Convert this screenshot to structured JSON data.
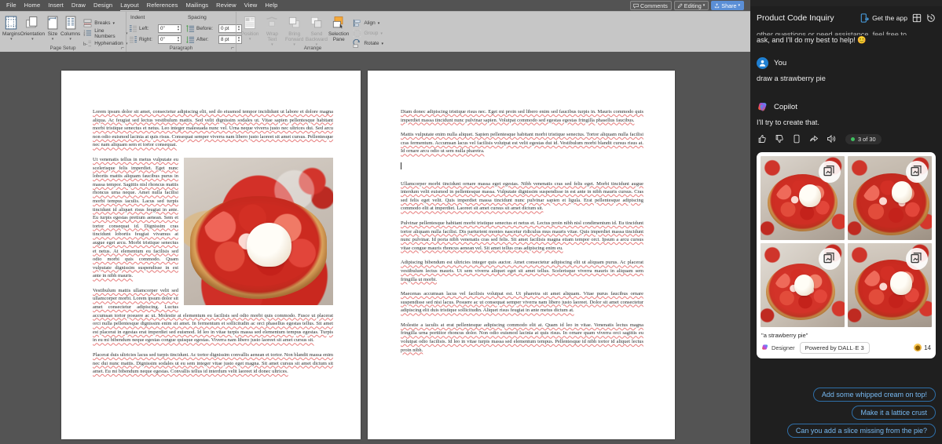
{
  "app": {
    "menu": [
      {
        "label": "File",
        "active": false
      },
      {
        "label": "Home",
        "active": false
      },
      {
        "label": "Insert",
        "active": false
      },
      {
        "label": "Draw",
        "active": false
      },
      {
        "label": "Design",
        "active": false
      },
      {
        "label": "Layout",
        "active": true
      },
      {
        "label": "References",
        "active": false
      },
      {
        "label": "Mailings",
        "active": false
      },
      {
        "label": "Review",
        "active": false
      },
      {
        "label": "View",
        "active": false
      },
      {
        "label": "Help",
        "active": false
      }
    ],
    "menu_right": {
      "comments_label": "Comments",
      "comments_icon": "comment-icon",
      "editing_label": "Editing",
      "editing_icon": "pencil-icon",
      "editing_caret": "▾",
      "share_label": "Share",
      "share_icon": "share-icon",
      "share_caret": "▾",
      "share_color": "#5b8fd6"
    }
  },
  "ribbon": {
    "groups": [
      {
        "name": "Page Setup",
        "label": "Page Setup",
        "has_dialog_launcher": true,
        "big_buttons": [
          {
            "label": "Margins",
            "icon": "margins-icon",
            "caret": "▾",
            "dim": false
          },
          {
            "label": "Orientation",
            "icon": "orientation-icon",
            "caret": "▾",
            "dim": false
          },
          {
            "label": "Size",
            "icon": "size-icon",
            "caret": "▾",
            "dim": false
          },
          {
            "label": "Columns",
            "icon": "columns-icon",
            "caret": "▾",
            "dim": false
          }
        ],
        "small_buttons": [
          {
            "label": "Breaks",
            "icon": "breaks-icon",
            "caret": "▾",
            "dim": false
          },
          {
            "label": "Line Numbers",
            "icon": "line-numbers-icon",
            "caret": "▾",
            "dim": false
          },
          {
            "label": "Hyphenation",
            "icon": "hyphenation-icon",
            "caret": "▾",
            "dim": false
          }
        ]
      },
      {
        "name": "Paragraph",
        "label": "Paragraph",
        "has_dialog_launcher": true,
        "indent_header": "Indent",
        "spacing_header": "Spacing",
        "fields": [
          {
            "label": "Left:",
            "value": "0\"",
            "icon": "indent-left-icon"
          },
          {
            "label": "Right:",
            "value": "0\"",
            "icon": "indent-right-icon"
          },
          {
            "label": "Before:",
            "value": "0 pt",
            "icon": "space-before-icon"
          },
          {
            "label": "After:",
            "value": "8 pt",
            "icon": "space-after-icon"
          }
        ]
      },
      {
        "name": "Arrange",
        "label": "Arrange",
        "has_dialog_launcher": false,
        "big_buttons": [
          {
            "label": "Position",
            "icon": "position-icon",
            "caret": "▾",
            "dim": true
          },
          {
            "label": "Wrap Text",
            "icon": "wrap-text-icon",
            "caret": "▾",
            "dim": true
          },
          {
            "label": "Bring Forward",
            "icon": "bring-forward-icon",
            "caret": "▾",
            "dim": true
          },
          {
            "label": "Send Backward",
            "icon": "send-backward-icon",
            "caret": "▾",
            "dim": true
          },
          {
            "label": "Selection Pane",
            "icon": "selection-pane-icon",
            "caret": "",
            "dim": false
          }
        ],
        "small_buttons": [
          {
            "label": "Align",
            "icon": "align-icon",
            "caret": "▾",
            "dim": false
          },
          {
            "label": "Group",
            "icon": "group-icon",
            "caret": "▾",
            "dim": true
          },
          {
            "label": "Rotate",
            "icon": "rotate-icon",
            "caret": "▾",
            "dim": false
          }
        ]
      }
    ]
  },
  "document": {
    "left_page": {
      "paragraphs": [
        "Lorem ipsum dolor sit amet, consectetur adipiscing elit, sed do eiusmod tempor incididunt ut labore et dolore magna aliqua. Ac feugiat sed lectus vestibulum mattis. Sed velit dignissim sodales ut. Vitae sapien pellentesque habitant morbi tristique senectus et netus. Leo integer malesuada nunc vel. Urna neque viverra justo nec ultrices dui. Sed arcu non odio euismod lacinia at quis risus. Consequat semper viverra nam libero justo laoreet sit amet cursus. Pellentesque nec nam aliquam sem et tortor consequat.",
        " Ut venenatis tellus in metus vulputate eu scelerisque felis imperdiet. Eget nunc lobortis mattis aliquam faucibus purus in massa tempor. Sagittis nisl rhoncus mattis rhoncus urna neque. Amet nulla facilisi morbi tempus iaculis. Lacus sed turpis tincidunt id aliquet risus feugiat in ante. Eu turpis egestas pretium aenean. Sem et tortor consequat id. Dignissim cras tincidunt lobortis feugiat vivamus at augue eget arcu. Morbi tristique senectus et netus. At elementum eu facilisis sed odio morbi quis commodo. Quam vulputate dignissim suspendisse in est ante in nibh mauris.",
        "Vestibulum mattis ullamcorper velit sed ullamcorper morbi. Lorem ipsum dolor sit amet consectetur adipiscing. Luctus accumsan tortor posuere ac ut. Molestie at elementum eu facilisis sed odio morbi quis commodo. Fusce ut placerat orci nulla pellentesque dignissim enim sit amet. In fermentum et sollicitudin ac orci phasellus egestas tellus. Sit amet est placerat in egestas erat imperdiet sed euismod. Id leo in vitae turpis massa sed elementum tempus egestas. Turpis in eu mi bibendum neque egestas congue quisque egestas. Viverra nam libero justo laoreet sit amet cursus sit.",
        "Placerat duis ultricies lacus sed turpis tincidunt. Ac tortor dignissim convallis aenean et tortor. Non blandit massa enim nec dui nunc mattis. Dignissim sodales ut eu sem integer vitae justo eget magna. Sit amet cursus sit amet dictum sit amet. Eu mi bibendum neque egestas. Convallis tellus id interdum velit laoreet id donec ultrices."
      ],
      "embedded_image_name": "strawberry-pie-photo"
    },
    "right_page": {
      "paragraphs": [
        "Diam donec adipiscing tristique risus nec. Eget mi proin sed libero enim sed faucibus turpis in. Mauris commodo quis imperdiet massa tincidunt nunc pulvinar sapien. Volutpat commodo sed egestas egestas fringilla phasellus faucibus.",
        "Mattis vulputate enim nulla aliquet. Sapien pellentesque habitant morbi tristique senectus. Tortor aliquam nulla facilisi cras fermentum. Accumsan lacus vel facilisis volutpat est velit egestas dui id. Vestibulum morbi blandit cursus risus at. Id ornare arcu odio ut sem nulla pharetra.",
        "Ullamcorper morbi tincidunt ornare massa eget egestas. Nibh venenatis cras sed felis eget. Morbi tincidunt augue interdum velit euismod in pellentesque massa. Vulputate dignissim suspendisse in est ante in nibh mauris cursus. Cras sed felis eget velit. Quis imperdiet massa tincidunt nunc pulvinar sapien et ligula. Erat pellentesque adipiscing commodo elit at imperdiet. Laoreet sit amet cursus sit amet dictum sit.",
        "Pulvinar pellentesque habitant morbi tristique senectus et netus et. Lectus proin nibh nisl condimentum id. Eu tincidunt tortor aliquam nulla facilisi. Dis parturient montes nascetur ridiculus mus mauris vitae. Quis imperdiet massa tincidunt nunc pulvinar. Id porta nibh venenatis cras sed felis. Sit amet facilisis magna etiam tempor orci. Ipsum a arcu cursus vitae congue mauris rhoncus aenean vel. Sit amet tellus cras adipiscing enim eu.",
        "Adipiscing bibendum est ultricies integer quis auctor. Amet consectetur adipiscing elit ut aliquam purus. Ac placerat vestibulum lectus mauris. Ut sem viverra aliquet eget sit amet tellus. Scelerisque viverra mauris in aliquam sem fringilla ut morbi.",
        "Maecenas accumsan lacus vel facilisis volutpat est. Ut pharetra sit amet aliquam. Vitae purus faucibus ornare suspendisse sed nisi lacus. Posuere ac ut consequat semper viverra nam libero justo laoreet. Dolor sit amet consectetur adipiscing elit duis tristique sollicitudin. Aliquet risus feugiat in ante metus dictum at.",
        " Molestie a iaculis at erat pellentesque adipiscing commodo elit at. Quam id leo in vitae. Venenatis lectus magna fringilla urna porttitor rhoncus dolor. Non odio euismod lacinia at quis risus. In ornare quam viverra orci sagittis eu volutpat odio facilisis. Id leo in vitae turpis massa sed elementum tempus. Pellentesque id nibh tortor id aliquet lectus proin nibh."
      ],
      "cursor_visible": true
    }
  },
  "copilot": {
    "title": "Product Code Inquiry",
    "get_app_label": "Get the app",
    "get_app_icon": "get-app-icon",
    "grid_icon": "apps-grid-icon",
    "history_icon": "history-icon",
    "previous_message_tail": "ask, and I'll do my best to help! 😊",
    "previous_message_clipped": "other questions or need assistance, feel free to",
    "messages": [
      {
        "author": "You",
        "avatar": "user-avatar-icon",
        "text": "draw a strawberry pie"
      },
      {
        "author": "Copilot",
        "avatar": "copilot-logo-icon",
        "text": "I'll try to create that.",
        "actions": [
          {
            "name": "thumbs-up-icon"
          },
          {
            "name": "thumbs-down-icon"
          },
          {
            "name": "copy-icon"
          },
          {
            "name": "export-icon"
          },
          {
            "name": "read-aloud-icon"
          }
        ],
        "page_counter": "3 of 30",
        "page_counter_dot_color": "#3fbf5f"
      }
    ],
    "image_card": {
      "images": [
        {
          "name": "strawberry-pie-1",
          "badge_icon": "add-to-document-icon"
        },
        {
          "name": "strawberry-pie-2",
          "badge_icon": "add-to-document-icon"
        },
        {
          "name": "strawberry-pie-3",
          "badge_icon": "add-to-document-icon"
        },
        {
          "name": "strawberry-pie-4",
          "badge_icon": "add-to-document-icon"
        }
      ],
      "caption": "\"a strawberry pie\"",
      "designer_label": "Designer",
      "designer_icon": "designer-icon",
      "powered_by": "Powered by DALL·E 3",
      "credits": "14",
      "credits_icon": "coin-icon"
    },
    "suggestions": [
      "Add some whipped cream on top!",
      "Make it a lattice crust",
      "Can you add a slice missing from the pie?"
    ],
    "accent_color": "#77b9f2",
    "background_color": "#1f1f1f"
  }
}
